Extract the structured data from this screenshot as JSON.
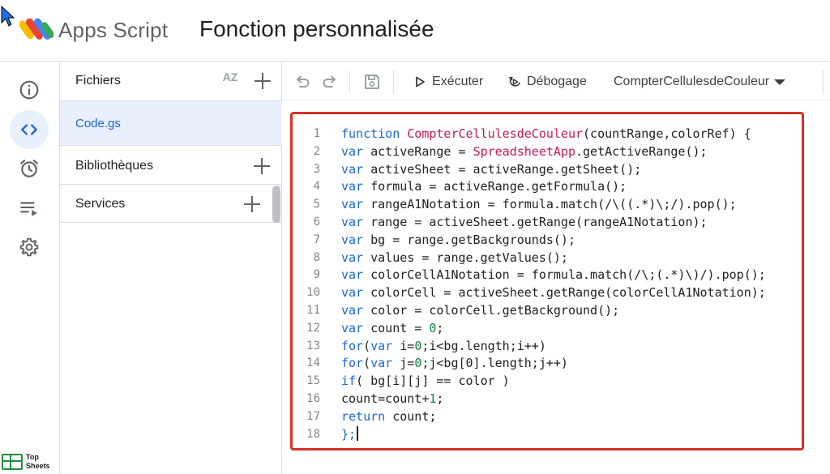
{
  "header": {
    "app_name": "Apps Script",
    "project_title": "Fonction personnalisée"
  },
  "rail": {
    "items": [
      {
        "icon": "info-icon",
        "label": "Overview"
      },
      {
        "icon": "code-icon",
        "label": "Editor",
        "active": true
      },
      {
        "icon": "alarm-icon",
        "label": "Triggers"
      },
      {
        "icon": "executions-icon",
        "label": "Executions"
      },
      {
        "icon": "gear-icon",
        "label": "Project settings"
      }
    ],
    "brand_line1": "Top",
    "brand_line2": "Sheets"
  },
  "files_panel": {
    "title": "Fichiers",
    "sort_icon": "AZ",
    "files": [
      {
        "name": "Code.gs",
        "selected": true
      }
    ],
    "sections": [
      {
        "label": "Bibliothèques"
      },
      {
        "label": "Services"
      }
    ]
  },
  "toolbar": {
    "run_label": "Exécuter",
    "debug_label": "Débogage",
    "function_selected": "CompterCellulesdeCouleur"
  },
  "colors": {
    "accent": "#1967d2",
    "highlight_border": "#d93025",
    "keyword": "#1967d2",
    "function_name": "#c2185b",
    "number": "#188038"
  },
  "code": {
    "lines": [
      {
        "n": "1",
        "kw": "function",
        "fn": "CompterCellulesdeCouleur",
        "rest": "(countRange,colorRef) {"
      },
      {
        "n": "2",
        "kw": "var",
        "pre": " activeRange = ",
        "fn": "SpreadsheetApp",
        "rest": ".getActiveRange();"
      },
      {
        "n": "3",
        "kw": "var",
        "rest": " activeSheet = activeRange.getSheet();"
      },
      {
        "n": "4",
        "kw": "var",
        "rest": " formula = activeRange.getFormula();"
      },
      {
        "n": "5",
        "kw": "var",
        "rest": " rangeA1Notation = formula.match(/\\((.*)\\;/).pop();"
      },
      {
        "n": "6",
        "kw": "var",
        "rest": " range = activeSheet.getRange(rangeA1Notation);"
      },
      {
        "n": "7",
        "kw": "var",
        "rest": " bg = range.getBackgrounds();"
      },
      {
        "n": "8",
        "kw": "var",
        "rest": " values = range.getValues();"
      },
      {
        "n": "9",
        "kw": "var",
        "rest": " colorCellA1Notation = formula.match(/\\;(.*)\\)/).pop();"
      },
      {
        "n": "10",
        "kw": "var",
        "rest": " colorCell = activeSheet.getRange(colorCellA1Notation);"
      },
      {
        "n": "11",
        "kw": "var",
        "rest": " color = colorCell.getBackground();"
      },
      {
        "n": "12",
        "kw": "var",
        "pre": " count = ",
        "num": "0",
        "rest": ";"
      },
      {
        "n": "13",
        "kw": "for",
        "pre": "(",
        "kw2": "var",
        "pre2": " i=",
        "num": "0",
        "rest": ";i<bg.length;i++)"
      },
      {
        "n": "14",
        "kw": "for",
        "pre": "(",
        "kw2": "var",
        "pre2": " j=",
        "num": "0",
        "rest": ";j<bg[0].length;j++)"
      },
      {
        "n": "15",
        "kw": "if",
        "rest": "( bg[i][j] == color )"
      },
      {
        "n": "16",
        "pre": "count=count+",
        "num": "1",
        "rest": ";"
      },
      {
        "n": "17",
        "kw": "return",
        "rest": " count;"
      },
      {
        "n": "18",
        "kw": "};",
        "caret": true
      }
    ]
  }
}
